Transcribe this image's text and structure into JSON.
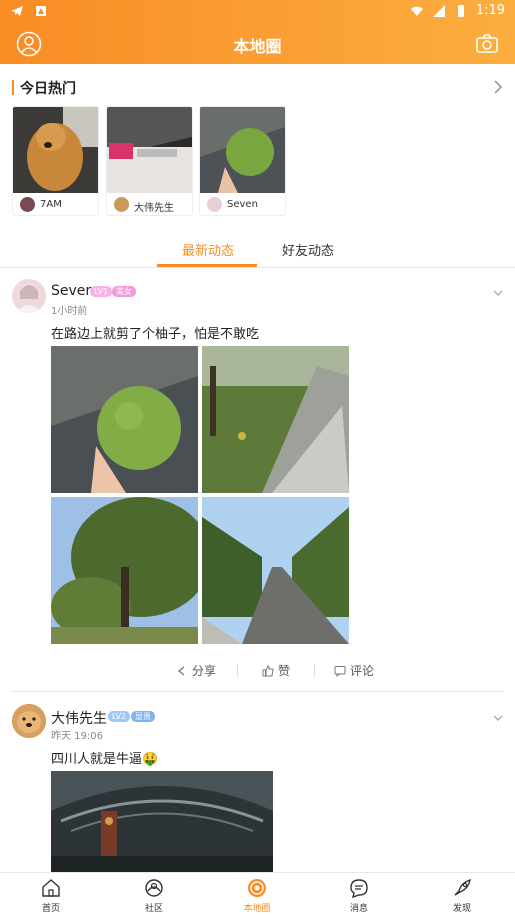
{
  "status_bar": {
    "time": "1:19"
  },
  "header": {
    "title": "本地圈"
  },
  "hot": {
    "title": "今日热门",
    "cards": [
      {
        "name": "7AM"
      },
      {
        "name": "大伟先生"
      },
      {
        "name": "Seven"
      }
    ]
  },
  "tabs": [
    {
      "label": "最新动态",
      "active": true
    },
    {
      "label": "好友动态",
      "active": false
    }
  ],
  "posts": [
    {
      "author": "Seven",
      "level": "LV1",
      "tag": "美女",
      "time": "1小时前",
      "text": "在路边上就剪了个柚子，怕是不敢吃",
      "actions": {
        "share": "分享",
        "like": "赞",
        "comment": "评论"
      }
    },
    {
      "author": "大伟先生",
      "level": "LV2",
      "tag": "显贵",
      "time": "昨天 19:06",
      "text": "四川人就是牛逼🤑"
    }
  ],
  "tabbar": [
    {
      "label": "首页",
      "icon": "home-icon"
    },
    {
      "label": "社区",
      "icon": "community-icon"
    },
    {
      "label": "本地圈",
      "icon": "local-circle-icon",
      "active": true
    },
    {
      "label": "消息",
      "icon": "message-icon"
    },
    {
      "label": "发现",
      "icon": "rocket-icon"
    }
  ],
  "colors": {
    "accent": "#f98c25",
    "badge_lv1": "#f7b3e4",
    "badge_lv2": "#9ccaf5"
  }
}
